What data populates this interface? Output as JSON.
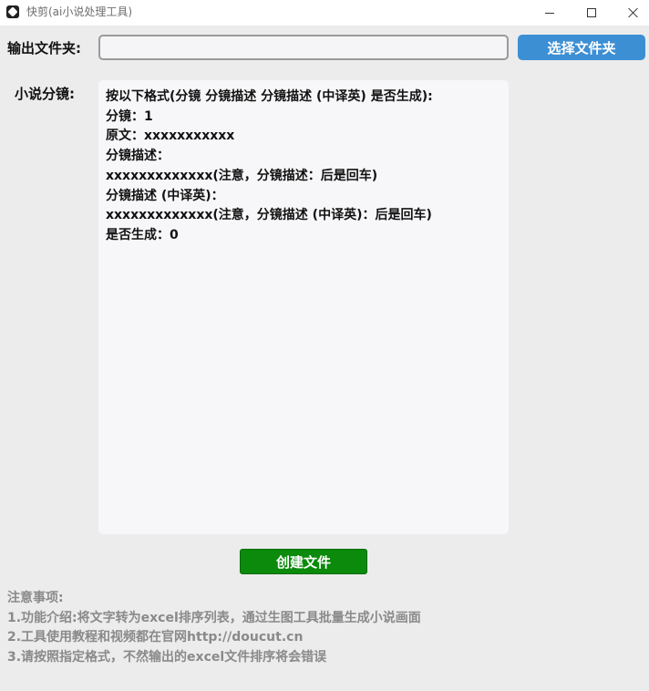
{
  "window": {
    "title": "快剪(ai小说处理工具)",
    "icon": "app-logo-icon"
  },
  "output_folder": {
    "label": "输出文件夹:",
    "value": "",
    "placeholder": "",
    "button_label": "选择文件夹"
  },
  "novel": {
    "label": "小说分镜:",
    "text": "按以下格式(分镜 分镜描述 分镜描述 (中译英) 是否生成):\n分镜：1\n原文：xxxxxxxxxxx\n分镜描述：\nxxxxxxxxxxxxx(注意，分镜描述：后是回车)\n分镜描述 (中译英)：\nxxxxxxxxxxxxx(注意，分镜描述 (中译英)：后是回车)\n是否生成：0"
  },
  "create_button_label": "创建文件",
  "notes": {
    "heading": "注意事项:",
    "items": [
      "1.功能介绍:将文字转为excel排序列表，通过生图工具批量生成小说画面",
      "2.工具使用教程和视频都在官网http://doucut.cn",
      "3.请按照指定格式，不然输出的excel文件排序将会错误"
    ]
  },
  "colors": {
    "choose_button": "#3d8fd4",
    "create_button": "#0b8a0b",
    "notes_text": "#8a8a8a",
    "background": "#ececec"
  }
}
